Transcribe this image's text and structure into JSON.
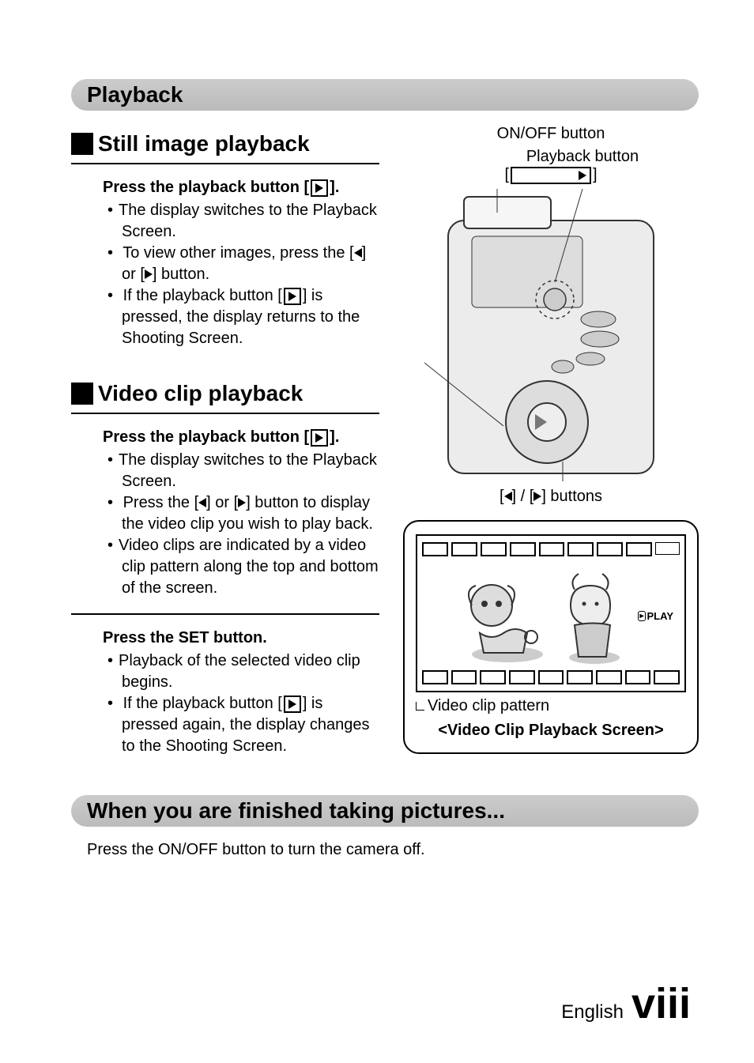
{
  "section_playback": "Playback",
  "still": {
    "title": "Still image playback",
    "step_prefix": "Press the playback button [",
    "step_suffix": "].",
    "b1": "The display switches to the Playback Screen.",
    "b2_a": "To view other images, press the [",
    "b2_b": "] or [",
    "b2_c": "] button.",
    "b3_a": "If the playback button [",
    "b3_b": "] is pressed, the display returns to the Shooting Screen."
  },
  "video": {
    "title": "Video clip playback",
    "step1_prefix": "Press the playback button [",
    "step1_suffix": "].",
    "b1": "The display switches to the Playback Screen.",
    "b2_a": "Press the [",
    "b2_b": "] or [",
    "b2_c": "] button to display the video clip you wish to play back.",
    "b3": "Video clips are indicated by a video clip pattern along the top and bottom of the screen.",
    "step2": "Press the SET button.",
    "s2b1": "Playback of the selected video clip begins.",
    "s2b2_a": "If the playback button [",
    "s2b2_b": "] is pressed again, the display changes to the Shooting Screen."
  },
  "right": {
    "onoff": "ON/OFF button",
    "playback_btn": "Playback button",
    "lr_a": "[",
    "lr_b": "] / [",
    "lr_c": "] buttons",
    "play_word": "PLAY",
    "video_pattern": "Video clip pattern",
    "caption": "<Video Clip Playback Screen>"
  },
  "finished": {
    "title": "When you are finished taking pictures...",
    "text": "Press the ON/OFF button to turn the camera off."
  },
  "footer": {
    "lang": "English",
    "page": "viii"
  }
}
